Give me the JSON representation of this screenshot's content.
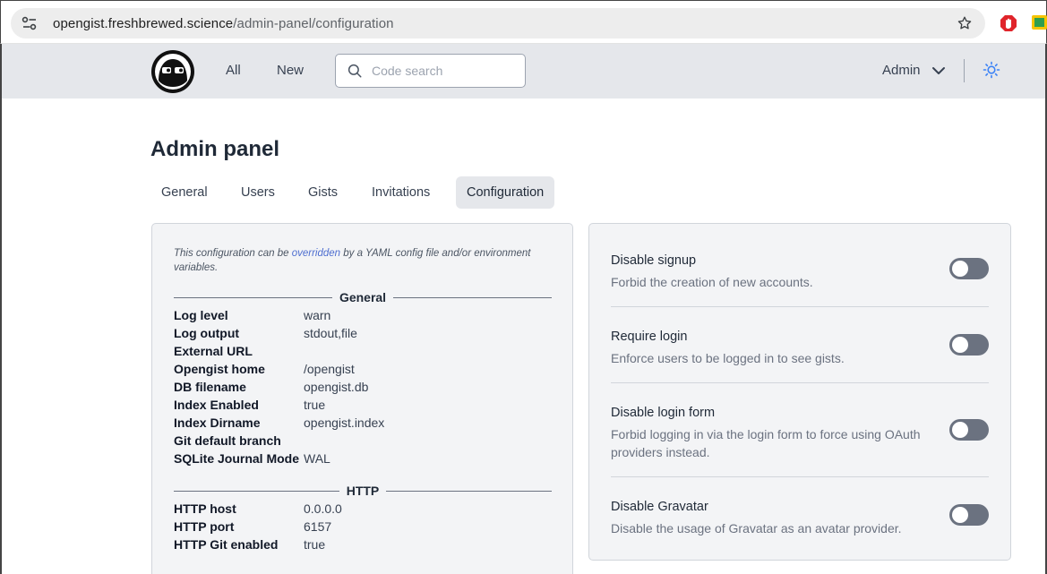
{
  "browser": {
    "url_host": "opengist.freshbrewed.science",
    "url_path": "/admin-panel/configuration"
  },
  "nav": {
    "all_label": "All",
    "new_label": "New",
    "search_placeholder": "Code search",
    "user_label": "Admin"
  },
  "page": {
    "title": "Admin panel",
    "tabs": [
      {
        "label": "General",
        "active": false
      },
      {
        "label": "Users",
        "active": false
      },
      {
        "label": "Gists",
        "active": false
      },
      {
        "label": "Invitations",
        "active": false
      },
      {
        "label": "Configuration",
        "active": true
      }
    ]
  },
  "config": {
    "note_before": "This configuration can be ",
    "note_link": "overridden",
    "note_after": " by a YAML config file and/or environment variables.",
    "general_heading": "General",
    "general_items": [
      {
        "key": "Log level",
        "value": "warn"
      },
      {
        "key": "Log output",
        "value": "stdout,file"
      },
      {
        "key": "External URL",
        "value": ""
      },
      {
        "key": "Opengist home",
        "value": "/opengist"
      },
      {
        "key": "DB filename",
        "value": "opengist.db"
      },
      {
        "key": "Index Enabled",
        "value": "true"
      },
      {
        "key": "Index Dirname",
        "value": "opengist.index"
      },
      {
        "key": "Git default branch",
        "value": ""
      },
      {
        "key": "SQLite Journal Mode",
        "value": "WAL"
      }
    ],
    "http_heading": "HTTP",
    "http_items": [
      {
        "key": "HTTP host",
        "value": "0.0.0.0"
      },
      {
        "key": "HTTP port",
        "value": "6157"
      },
      {
        "key": "HTTP Git enabled",
        "value": "true"
      }
    ]
  },
  "settings": [
    {
      "title": "Disable signup",
      "desc": "Forbid the creation of new accounts.",
      "enabled": false
    },
    {
      "title": "Require login",
      "desc": "Enforce users to be logged in to see gists.",
      "enabled": false
    },
    {
      "title": "Disable login form",
      "desc": "Forbid logging in via the login form to force using OAuth providers instead.",
      "enabled": false
    },
    {
      "title": "Disable Gravatar",
      "desc": "Disable the usage of Gravatar as an avatar provider.",
      "enabled": false
    }
  ],
  "colors": {
    "navbar_bg": "#e5e7eb",
    "panel_bg": "#f3f4f6",
    "toggle_off": "#6b7280",
    "link": "#4f6fd0"
  }
}
